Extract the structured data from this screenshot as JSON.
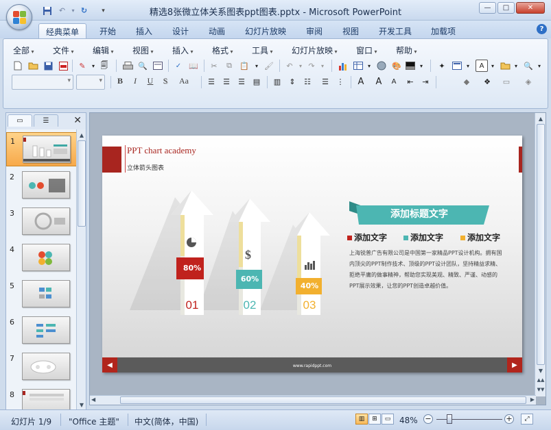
{
  "window": {
    "title": "精选8张微立体关系图表ppt图表.pptx - Microsoft PowerPoint",
    "controls": {
      "minimize": "—",
      "maximize": "□",
      "close": "✕"
    }
  },
  "quick_access": [
    "save-icon",
    "undo-icon",
    "redo-icon",
    "customize-icon"
  ],
  "ribbon_tabs": [
    {
      "label": "经典菜单",
      "active": true
    },
    {
      "label": "开始"
    },
    {
      "label": "插入"
    },
    {
      "label": "设计"
    },
    {
      "label": "动画"
    },
    {
      "label": "幻灯片放映"
    },
    {
      "label": "审阅"
    },
    {
      "label": "视图"
    },
    {
      "label": "开发工具"
    },
    {
      "label": "加载项"
    }
  ],
  "menus": [
    "全部",
    "文件",
    "编辑",
    "视图",
    "插入",
    "格式",
    "工具",
    "幻灯片放映",
    "窗口",
    "帮助"
  ],
  "format_buttons": {
    "bold": "B",
    "italic": "I",
    "underline": "U",
    "shadow": "S",
    "font_case": "Aa"
  },
  "slide_pane": {
    "tab_slides": "▭",
    "tab_outline": "☰",
    "close": "✕",
    "slides": [
      {
        "num": "1"
      },
      {
        "num": "2"
      },
      {
        "num": "3"
      },
      {
        "num": "4"
      },
      {
        "num": "5"
      },
      {
        "num": "6"
      },
      {
        "num": "7"
      },
      {
        "num": "8"
      }
    ],
    "selected": 1
  },
  "slide": {
    "title": "PPT chart academy",
    "subtitle": "立体箭头图表",
    "arrows": [
      {
        "percent": "80%",
        "number": "01",
        "color": "#c0221d",
        "icon": "pie-chart-icon"
      },
      {
        "percent": "60%",
        "number": "02",
        "color": "#4cb6b2",
        "icon": "dollar-icon"
      },
      {
        "percent": "40%",
        "number": "03",
        "color": "#f2b02f",
        "icon": "bar-chart-icon"
      }
    ],
    "banner": "添加标题文字",
    "legend": [
      {
        "label": "添加文字",
        "color": "#c0221d"
      },
      {
        "label": "添加文字",
        "color": "#4cb6b2"
      },
      {
        "label": "添加文字",
        "color": "#f2b02f"
      }
    ],
    "description": "上海锐普广告有限公司是中国第一家精品PPT设计机构。拥有国内顶尖的PPT制作技术、顶级的PPT设计团队，坚持精益求精、拒绝平庸的做事精神，帮助您实现美观、精致、严谨、动感的PPT展示效果，让您的PPT创造卓越价值。",
    "footer_url": "www.rapidppt.com",
    "footer_prev": "◀",
    "footer_next": "▶"
  },
  "statusbar": {
    "slide_info": "幻灯片 1/9",
    "theme": "\"Office 主题\"",
    "language": "中文(简体，中国)",
    "zoom": "48%",
    "zoom_out": "−",
    "zoom_in": "+"
  }
}
